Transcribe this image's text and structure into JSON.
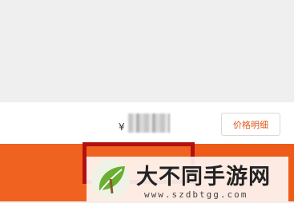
{
  "price": {
    "currency": "¥"
  },
  "actions": {
    "price_detail_label": "价格明细"
  },
  "watermark": {
    "title": "大不同手游网",
    "url": "www.szdbtgg.com"
  },
  "colors": {
    "accent": "#f0621f",
    "highlight": "#b30f0f",
    "logo_green": "#5a9e2e"
  }
}
